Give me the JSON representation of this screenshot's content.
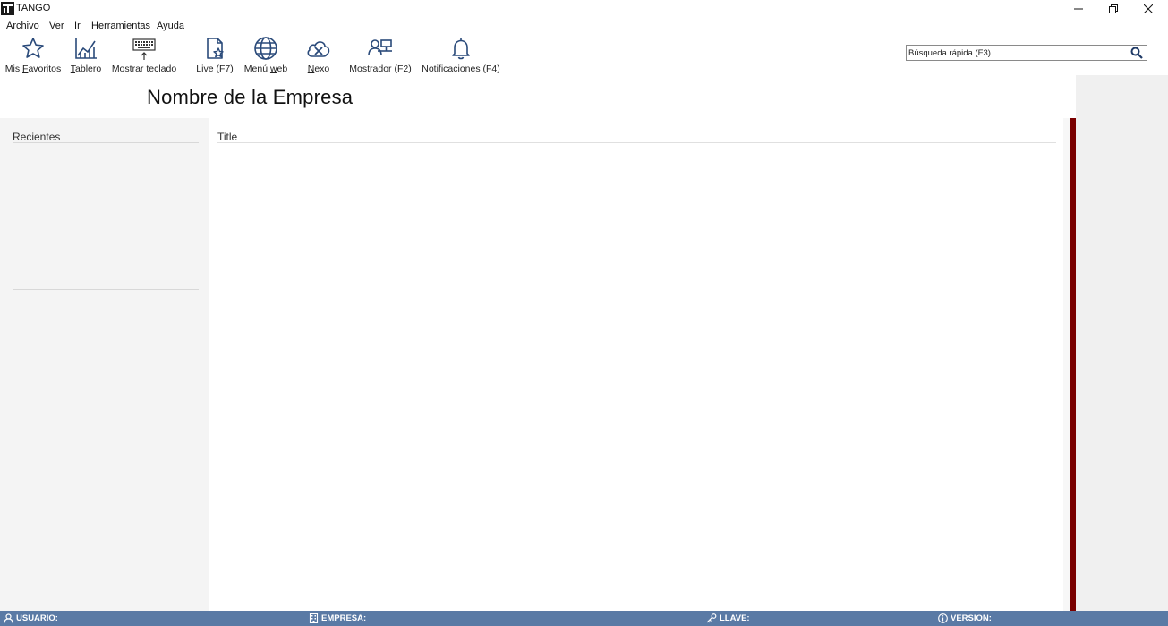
{
  "window": {
    "title": "TANGO"
  },
  "menu": [
    {
      "pre": "",
      "ul": "A",
      "post": "rchivo"
    },
    {
      "pre": "",
      "ul": "V",
      "post": "er"
    },
    {
      "pre": "",
      "ul": "I",
      "post": "r"
    },
    {
      "pre": "",
      "ul": "H",
      "post": "erramientas"
    },
    {
      "pre": "",
      "ul": "A",
      "post": "yuda"
    }
  ],
  "toolbar": [
    {
      "icon": "star-icon",
      "pre": "Mis ",
      "ul": "F",
      "post": "avoritos"
    },
    {
      "icon": "chart-icon",
      "pre": "",
      "ul": "T",
      "post": "ablero"
    },
    {
      "icon": "keyboard-icon",
      "pre": "Mostrar teclado",
      "ul": "",
      "post": ""
    },
    {
      "icon": "live-icon",
      "pre": "Live (F7)",
      "ul": "",
      "post": ""
    },
    {
      "icon": "globe-icon",
      "pre": "Menú ",
      "ul": "w",
      "post": "eb"
    },
    {
      "icon": "cloud-x-icon",
      "pre": "",
      "ul": "N",
      "post": "exo"
    },
    {
      "icon": "counter-icon",
      "pre": "Mostrador (F2)",
      "ul": "",
      "post": ""
    },
    {
      "icon": "bell-icon",
      "pre": "Notificaciones (F4)",
      "ul": "",
      "post": ""
    }
  ],
  "search": {
    "placeholder": "Búsqueda rápida (F3)"
  },
  "company": {
    "name": "Nombre de la Empresa"
  },
  "recientes": {
    "title": "Recientes"
  },
  "main": {
    "title": "Title"
  },
  "status": {
    "usuario": "USUARIO:",
    "empresa": "EMPRESA:",
    "llave": "LLAVE:",
    "version": "VERSION:"
  },
  "colors": {
    "accent_bar": "#7a0000",
    "statusbar": "#5a7aa5",
    "icon_blue": "#2a4a7a"
  }
}
